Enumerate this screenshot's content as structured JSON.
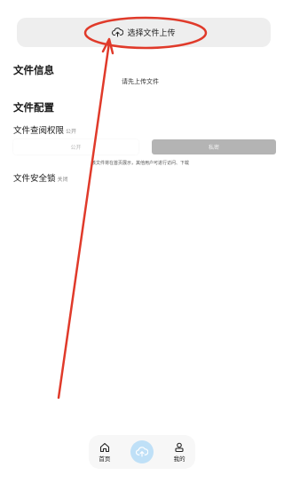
{
  "upload": {
    "label": "选择文件上传",
    "icon": "cloud-upload-icon"
  },
  "file_info": {
    "title": "文件信息",
    "hint": "请先上传文件"
  },
  "file_config": {
    "title": "文件配置",
    "permission": {
      "label": "文件查阅权限",
      "current": "公开",
      "options": [
        "公开",
        "私密"
      ],
      "note": "该文件将在首页展示，其他用户可进行访问、下载"
    },
    "lock": {
      "label": "文件安全锁",
      "status": "关闭"
    }
  },
  "bottom_nav": {
    "items": [
      {
        "label": "首页",
        "icon": "home-icon"
      },
      {
        "label": "",
        "icon": "cloud-upload-icon"
      },
      {
        "label": "我的",
        "icon": "profile-icon"
      }
    ]
  },
  "colors": {
    "annotation": "#e03a2a",
    "upload_bg": "#eeeeee",
    "segment_selected": "#b4b4b4",
    "nav_center": "#bfe0f7"
  }
}
